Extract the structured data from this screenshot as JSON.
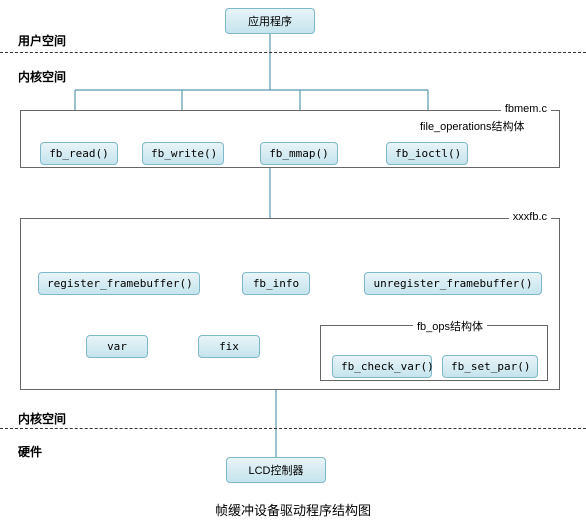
{
  "sections": {
    "user_space": "用户空间",
    "kernel_space": "内核空间",
    "kernel_space2": "内核空间",
    "hardware": "硬件"
  },
  "nodes": {
    "app": "应用程序",
    "fb_read": "fb_read()",
    "fb_write": "fb_write()",
    "fb_mmap": "fb_mmap()",
    "fb_ioctl": "fb_ioctl()",
    "register_fb": "register_framebuffer()",
    "fb_info": "fb_info",
    "unregister_fb": "unregister_framebuffer()",
    "var": "var",
    "fix": "fix",
    "fb_check_var": "fb_check_var()",
    "fb_set_par": "fb_set_par()",
    "lcd": "LCD控制器"
  },
  "groups": {
    "fbmem_file": "fbmem.c",
    "fbmem_struct": "file_operations结构体",
    "xxxfb_file": "xxxfb.c",
    "fb_ops_struct": "fb_ops结构体"
  },
  "caption": "帧缓冲设备驱动程序结构图"
}
